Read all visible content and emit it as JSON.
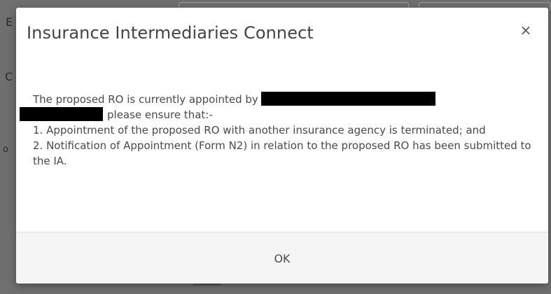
{
  "background": {
    "letters": [
      "E",
      "C",
      "o"
    ]
  },
  "modal": {
    "title": "Insurance Intermediaries Connect",
    "close_glyph": "×",
    "message": {
      "line1_prefix": "The proposed RO is currently appointed by",
      "line2_suffix": "please ensure that:-",
      "item1": "1. Appointment of the proposed RO with another insurance agency is terminated; and",
      "item2": "2. Notification of Appointment (Form N2) in relation to the proposed RO has been submitted to the IA."
    },
    "ok_label": "OK"
  },
  "colors": {
    "overlay": "#6f6f6f",
    "modal_bg": "#ffffff",
    "footer_bg": "#f5f5f5",
    "text": "#4a4a4a",
    "redaction": "#000000"
  }
}
